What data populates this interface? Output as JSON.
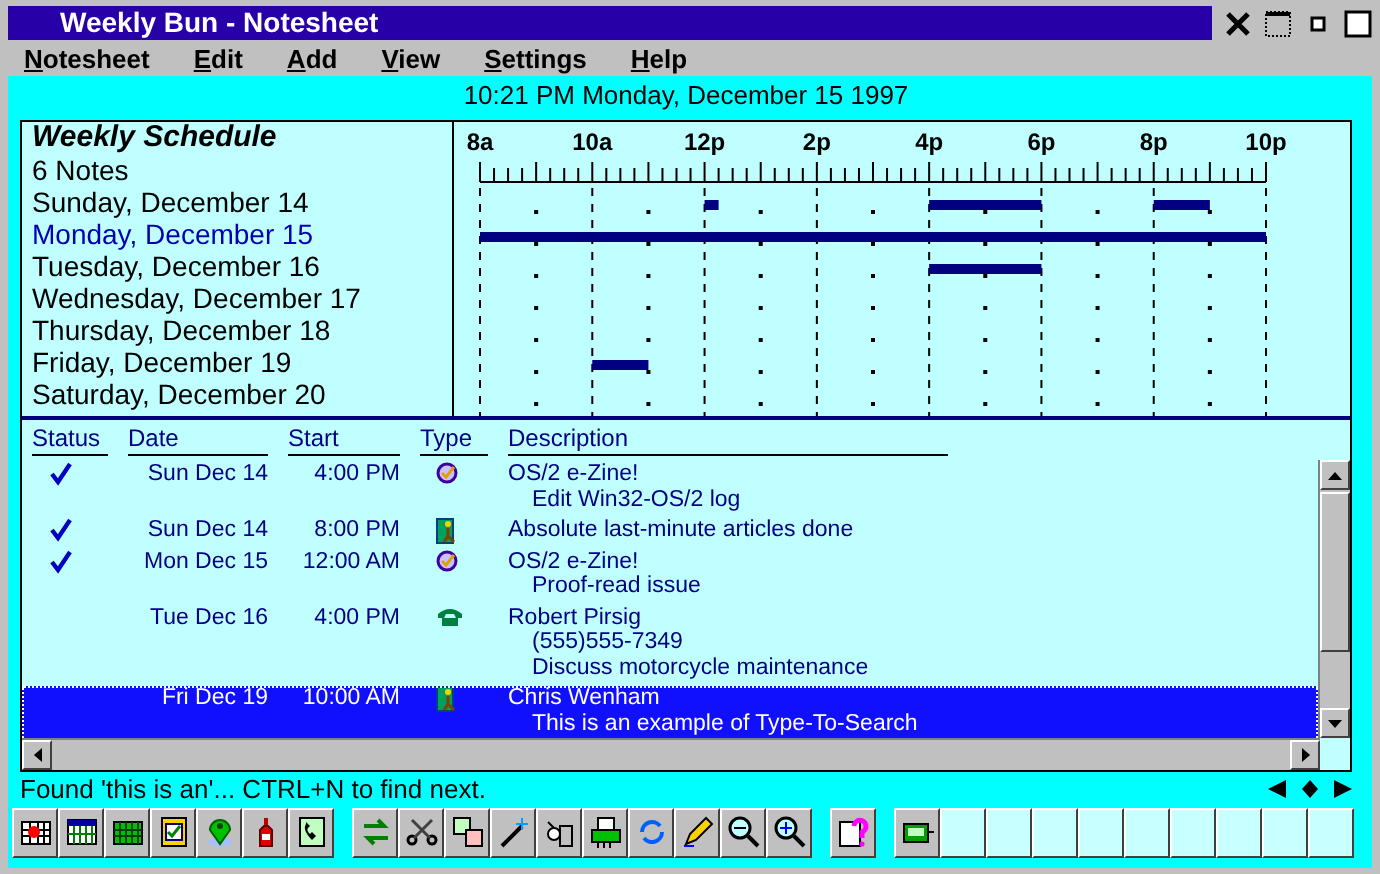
{
  "window": {
    "title": "Weekly Bun - Notesheet"
  },
  "menu": [
    {
      "label": "Notesheet"
    },
    {
      "label": "Edit"
    },
    {
      "label": "Add"
    },
    {
      "label": "View"
    },
    {
      "label": "Settings"
    },
    {
      "label": "Help"
    }
  ],
  "date_line": "10:21 PM Monday, December 15 1997",
  "schedule": {
    "title": "Weekly Schedule",
    "note_count": "6 Notes",
    "hours": [
      "8a",
      "10a",
      "12p",
      "2p",
      "4p",
      "6p",
      "8p",
      "10p"
    ],
    "days": [
      {
        "label": "Sunday, December 14",
        "selected": false
      },
      {
        "label": "Monday, December 15",
        "selected": true
      },
      {
        "label": "Tuesday, December 16",
        "selected": false
      },
      {
        "label": "Wednesday, December 17",
        "selected": false
      },
      {
        "label": "Thursday, December 18",
        "selected": false
      },
      {
        "label": "Friday, December 19",
        "selected": false
      },
      {
        "label": "Saturday, December 20",
        "selected": false
      }
    ]
  },
  "notes": {
    "columns": [
      "Status",
      "Date",
      "Start",
      "Type",
      "Description"
    ],
    "rows": [
      {
        "done": true,
        "date": "Sun Dec 14",
        "start": "4:00 PM",
        "kind": "task",
        "lines": [
          "OS/2 e-Zine!",
          "Edit Win32-OS/2 log"
        ],
        "selected": false
      },
      {
        "done": true,
        "date": "Sun Dec 14",
        "start": "8:00 PM",
        "kind": "event",
        "lines": [
          "Absolute last-minute articles done"
        ],
        "selected": false
      },
      {
        "done": true,
        "date": "Mon Dec 15",
        "start": "12:00 AM",
        "kind": "task",
        "lines": [
          "OS/2 e-Zine!",
          "Proof-read issue"
        ],
        "selected": false
      },
      {
        "done": false,
        "date": "Tue Dec 16",
        "start": "4:00 PM",
        "kind": "call",
        "lines": [
          "Robert Pirsig",
          "(555)555-7349",
          "Discuss motorcycle maintenance"
        ],
        "selected": false
      },
      {
        "done": false,
        "date": "Fri Dec 19",
        "start": "10:00 AM",
        "kind": "event",
        "lines": [
          "Chris Wenham",
          "This is an example of Type-To-Search"
        ],
        "selected": true
      }
    ]
  },
  "status_bar": "Found 'this is an'... CTRL+N to find next."
}
